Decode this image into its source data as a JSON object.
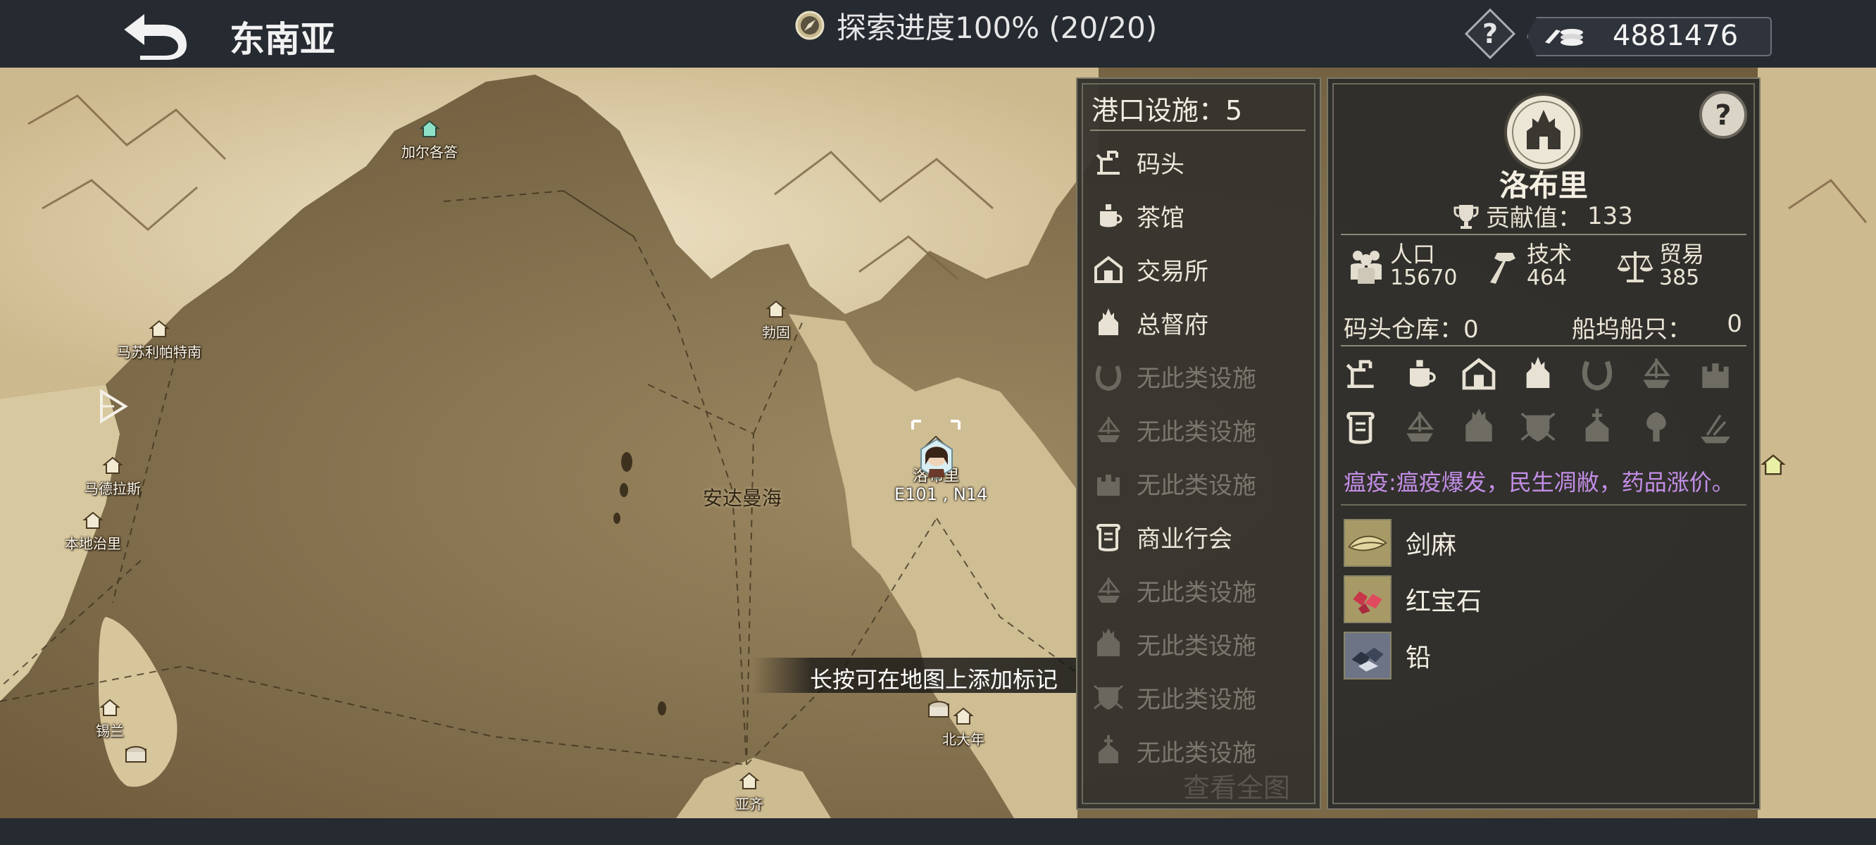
{
  "header": {
    "back_icon": "back-arrow-icon",
    "title": "东南亚",
    "explore_icon": "compass-icon",
    "explore_text": "探索进度100% (20/20)",
    "help_icon": "question-icon",
    "currency_icon": "coins-icon",
    "currency_value": "4881476"
  },
  "map": {
    "sea_label": "安达曼海",
    "selected_port": "洛布里",
    "coordinates": "E101 , N14",
    "hint": "长按可在地图上添加标记",
    "ports": [
      {
        "name": "加尔各答"
      },
      {
        "name": "马苏利帕特南"
      },
      {
        "name": "勃固"
      },
      {
        "name": "马德拉斯"
      },
      {
        "name": "本地治里"
      },
      {
        "name": "锡兰"
      },
      {
        "name": "洛布里"
      },
      {
        "name": "北大年"
      },
      {
        "name": "亚齐"
      }
    ]
  },
  "facilities": {
    "title": "港口设施：5",
    "view_all": "查看全图",
    "items": [
      {
        "label": "码头",
        "icon": "dock-icon",
        "available": true
      },
      {
        "label": "茶馆",
        "icon": "teapot-icon",
        "available": true
      },
      {
        "label": "交易所",
        "icon": "exchange-house-icon",
        "available": true
      },
      {
        "label": "总督府",
        "icon": "governor-palace-icon",
        "available": true
      },
      {
        "label": "无此类设施",
        "icon": "horseshoe-icon",
        "available": false
      },
      {
        "label": "无此类设施",
        "icon": "ship-icon",
        "available": false
      },
      {
        "label": "无此类设施",
        "icon": "castle-icon",
        "available": false
      },
      {
        "label": "商业行会",
        "icon": "scroll-icon",
        "available": true
      },
      {
        "label": "无此类设施",
        "icon": "ship-icon",
        "available": false
      },
      {
        "label": "无此类设施",
        "icon": "cathedral-icon",
        "available": false
      },
      {
        "label": "无此类设施",
        "icon": "shield-crest-icon",
        "available": false
      },
      {
        "label": "无此类设施",
        "icon": "church-icon",
        "available": false
      }
    ]
  },
  "port_info": {
    "emblem_icon": "city-emblem-icon",
    "name": "洛布里",
    "contribution_label": "贡献值：",
    "contribution_value": "133",
    "stats": [
      {
        "label": "人口",
        "value": "15670",
        "icon": "population-icon"
      },
      {
        "label": "技术",
        "value": "464",
        "icon": "hammer-icon"
      },
      {
        "label": "贸易",
        "value": "385",
        "icon": "scales-icon"
      }
    ],
    "warehouse_label": "码头仓库：0",
    "shipyard_label": "船坞船只：",
    "shipyard_value": "0",
    "building_icons": [
      {
        "icon": "dock-icon",
        "active": true
      },
      {
        "icon": "teapot-icon",
        "active": true
      },
      {
        "icon": "exchange-house-icon",
        "active": true
      },
      {
        "icon": "governor-palace-icon",
        "active": true
      },
      {
        "icon": "horseshoe-icon",
        "active": false
      },
      {
        "icon": "ship-icon",
        "active": false
      },
      {
        "icon": "castle-icon",
        "active": false
      },
      {
        "icon": "scroll-icon",
        "active": true
      },
      {
        "icon": "ship-icon",
        "active": false
      },
      {
        "icon": "cathedral-icon",
        "active": false
      },
      {
        "icon": "shield-crest-icon",
        "active": false
      },
      {
        "icon": "church-icon",
        "active": false
      },
      {
        "icon": "tree-icon",
        "active": false
      },
      {
        "icon": "wreck-icon",
        "active": false
      }
    ],
    "event": "瘟疫:瘟疫爆发，民生凋敝，药品涨价。",
    "event_color": "#c48ee8",
    "goods": [
      {
        "name": "剑麻",
        "icon": "sisal-icon"
      },
      {
        "name": "红宝石",
        "icon": "ruby-icon"
      },
      {
        "name": "铅",
        "icon": "lead-ore-icon"
      }
    ]
  },
  "colors": {
    "topbar": "#262a31",
    "panel": "#34322e",
    "panel_border": "#7c7866",
    "map_sea": "#8e7a55",
    "map_land": "#d9c9a3",
    "dim_text": "#7a776e"
  }
}
